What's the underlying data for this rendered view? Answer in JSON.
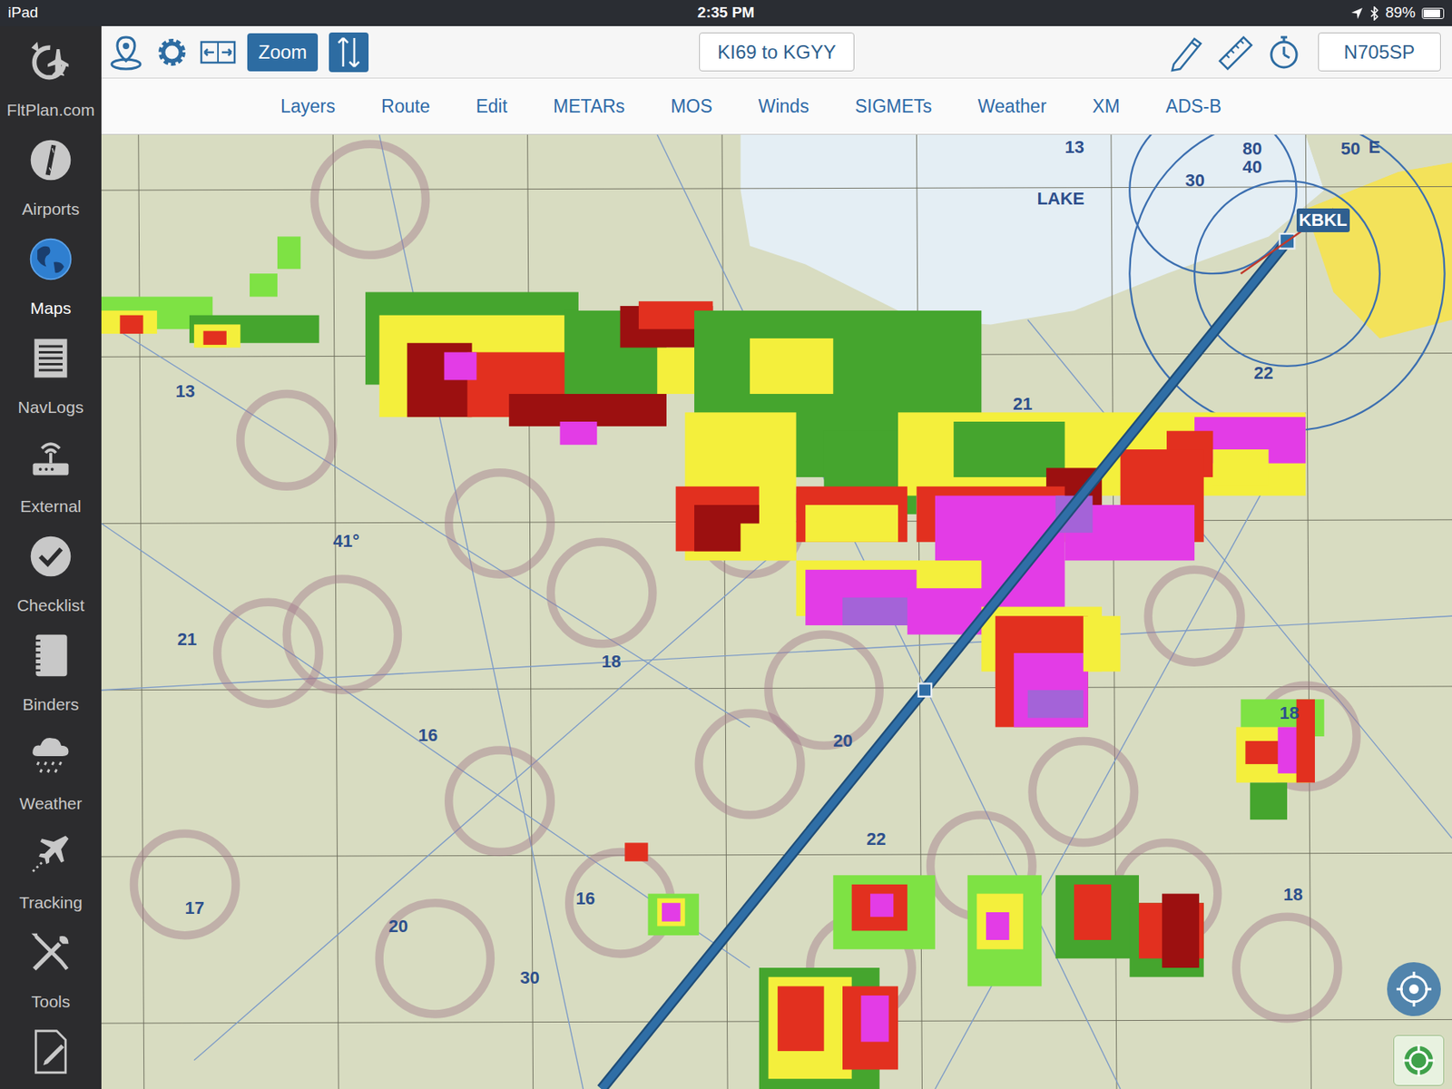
{
  "status_bar": {
    "device": "iPad",
    "time": "2:35 PM",
    "battery": "89%",
    "battery_level": 0.89
  },
  "sidebar": {
    "items": [
      {
        "label": "FltPlan.com",
        "selected": false
      },
      {
        "label": "Airports",
        "selected": false
      },
      {
        "label": "Maps",
        "selected": true
      },
      {
        "label": "NavLogs",
        "selected": false
      },
      {
        "label": "External",
        "selected": false
      },
      {
        "label": "Checklist",
        "selected": false
      },
      {
        "label": "Binders",
        "selected": false
      },
      {
        "label": "Weather",
        "selected": false
      },
      {
        "label": "Tracking",
        "selected": false
      },
      {
        "label": "Tools",
        "selected": false
      }
    ]
  },
  "toolbar": {
    "zoom": {
      "label": "Zoom",
      "selected": true
    },
    "route_button": "KI69 to KGYY",
    "aircraft_button": "N705SP"
  },
  "menu": [
    {
      "label": "Layers"
    },
    {
      "label": "Route"
    },
    {
      "label": "Edit"
    },
    {
      "label": "METARs"
    },
    {
      "label": "MOS"
    },
    {
      "label": "Winds"
    },
    {
      "label": "SIGMETs"
    },
    {
      "label": "Weather"
    },
    {
      "label": "XM"
    },
    {
      "label": "ADS-B"
    }
  ],
  "map": {
    "route": {
      "waypoint": "KBKL"
    },
    "labels": [
      "LAKE",
      "E",
      "13",
      "80",
      "40",
      "50",
      "30",
      "21",
      "22",
      "13",
      "21",
      "16",
      "18",
      "20",
      "17",
      "22",
      "18",
      "16",
      "30",
      "20",
      "18",
      "41°"
    ]
  }
}
